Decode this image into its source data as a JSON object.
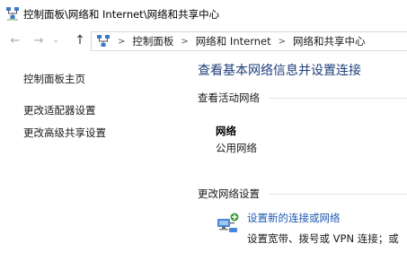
{
  "window": {
    "title": "控制面板\\网络和 Internet\\网络和共享中心",
    "icon": "network-share-center-icon"
  },
  "nav": {
    "back_icon": "arrow-left-icon",
    "forward_icon": "arrow-right-icon",
    "recent_icon": "chevron-down-icon",
    "up_icon": "arrow-up-icon",
    "breadcrumbs": [
      "控制面板",
      "网络和 Internet",
      "网络和共享中心"
    ],
    "separator": ">"
  },
  "sidebar": {
    "items": [
      {
        "label": "控制面板主页"
      },
      {
        "label": "更改适配器设置"
      },
      {
        "label": "更改高级共享设置"
      }
    ]
  },
  "main": {
    "heading": "查看基本网络信息并设置连接",
    "active_networks_title": "查看活动网络",
    "network": {
      "name": "网络",
      "type": "公用网络"
    },
    "change_settings_title": "更改网络设置",
    "task": {
      "icon": "network-setup-icon",
      "link": "设置新的连接或网络",
      "description": "设置宽带、拨号或 VPN 连接；或"
    }
  },
  "colors": {
    "heading": "#1e3f7a",
    "link": "#1e58b0",
    "disabled_nav": "#a8a8a8"
  }
}
